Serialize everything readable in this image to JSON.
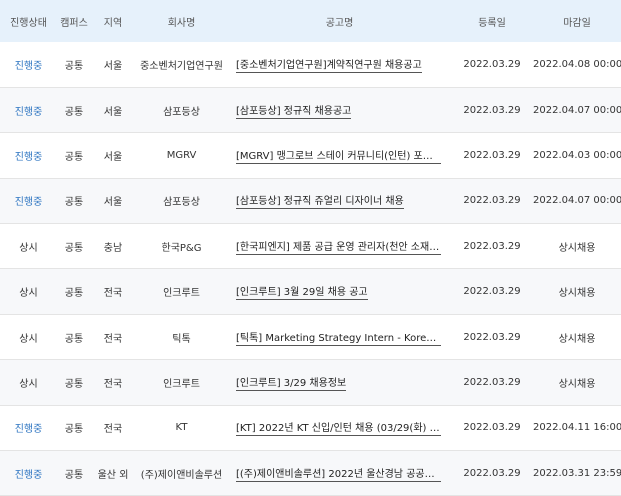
{
  "header": {
    "status": "진행상태",
    "campus": "캠퍼스",
    "region": "지역",
    "company": "회사명",
    "title": "공고명",
    "registered": "등록일",
    "deadline": "마감일"
  },
  "rows": [
    {
      "status": "진행중",
      "status_type": "ongoing",
      "campus": "공통",
      "region": "서울",
      "company": "중소벤처기업연구원",
      "title": "[중소벤처기업연구원]계약직연구원 채용공고",
      "registered": "2022.03.29",
      "deadline": "2022.04.08 00:00"
    },
    {
      "status": "진행중",
      "status_type": "ongoing",
      "campus": "공통",
      "region": "서울",
      "company": "삼포등상",
      "title": "[삼포등상] 정규직 채용공고",
      "registered": "2022.03.29",
      "deadline": "2022.04.07 00:00"
    },
    {
      "status": "진행중",
      "status_type": "ongoing",
      "campus": "공통",
      "region": "서울",
      "company": "MGRV",
      "title": "[MGRV] 맹그로브 스테이 커뮤니티(인턴) 포지…",
      "registered": "2022.03.29",
      "deadline": "2022.04.03 00:00"
    },
    {
      "status": "진행중",
      "status_type": "ongoing",
      "campus": "공통",
      "region": "서울",
      "company": "삼포등상",
      "title": "[삼포등상] 정규직 쥬얼리 디자이너 채용",
      "registered": "2022.03.29",
      "deadline": "2022.04.07 00:00"
    },
    {
      "status": "상시",
      "status_type": "always",
      "campus": "공통",
      "region": "충남",
      "company": "한국P&G",
      "title": "[한국피엔지] 제품 공급 운영 관리자(천안 소재) …",
      "registered": "2022.03.29",
      "deadline": "상시채용"
    },
    {
      "status": "상시",
      "status_type": "always",
      "campus": "공통",
      "region": "전국",
      "company": "인크루트",
      "title": "[인크루트] 3월 29일 채용 공고",
      "registered": "2022.03.29",
      "deadline": "상시채용"
    },
    {
      "status": "상시",
      "status_type": "always",
      "campus": "공통",
      "region": "전국",
      "company": "틱톡",
      "title": "[틱톡] Marketing Strategy Intern - Korea 채용",
      "registered": "2022.03.29",
      "deadline": "상시채용"
    },
    {
      "status": "상시",
      "status_type": "always",
      "campus": "공통",
      "region": "전국",
      "company": "인크루트",
      "title": "[인크루트] 3/29 채용정보",
      "registered": "2022.03.29",
      "deadline": "상시채용"
    },
    {
      "status": "진행중",
      "status_type": "ongoing",
      "campus": "공통",
      "region": "전국",
      "company": "KT",
      "title": "[KT] 2022년 KT 신입/인턴 채용 (03/29(화) 10…",
      "registered": "2022.03.29",
      "deadline": "2022.04.11 16:00"
    },
    {
      "status": "진행중",
      "status_type": "ongoing",
      "campus": "공통",
      "region": "울산 외",
      "company": "(주)제이앤비솔루션",
      "title": "[(주)제이앤비솔루션] 2022년 울산경남 공공기…",
      "registered": "2022.03.29",
      "deadline": "2022.03.31 23:59"
    }
  ]
}
